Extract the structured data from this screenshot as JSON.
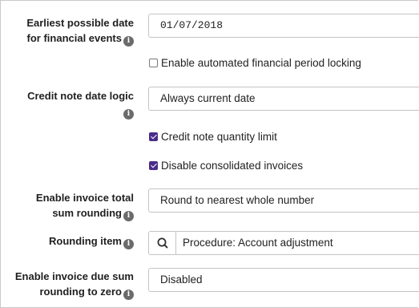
{
  "settings": {
    "earliest_date": {
      "label_line1": "Earliest possible date",
      "label_line2": "for financial events",
      "value": "01/07/2018"
    },
    "auto_period_locking": {
      "label": "Enable automated financial period locking",
      "checked": false
    },
    "credit_note_date_logic": {
      "label": "Credit note date logic",
      "value": "Always current date"
    },
    "credit_note_quantity_limit": {
      "label": "Credit note quantity limit",
      "checked": true
    },
    "disable_consolidated_invoices": {
      "label": "Disable consolidated invoices",
      "checked": true
    },
    "invoice_total_rounding": {
      "label_line1": "Enable invoice total",
      "label_line2": "sum rounding",
      "value": "Round to nearest whole number"
    },
    "rounding_item": {
      "label": "Rounding item",
      "value": "Procedure: Account adjustment"
    },
    "due_sum_rounding": {
      "label_line1": "Enable invoice due sum",
      "label_line2": "rounding to zero",
      "value": "Disabled"
    }
  },
  "icons": {
    "info": "info-icon",
    "search": "search-icon"
  },
  "colors": {
    "checkbox_checked": "#4a2c8a",
    "info_icon": "#6b6b6b",
    "border": "#c4c4c4"
  }
}
